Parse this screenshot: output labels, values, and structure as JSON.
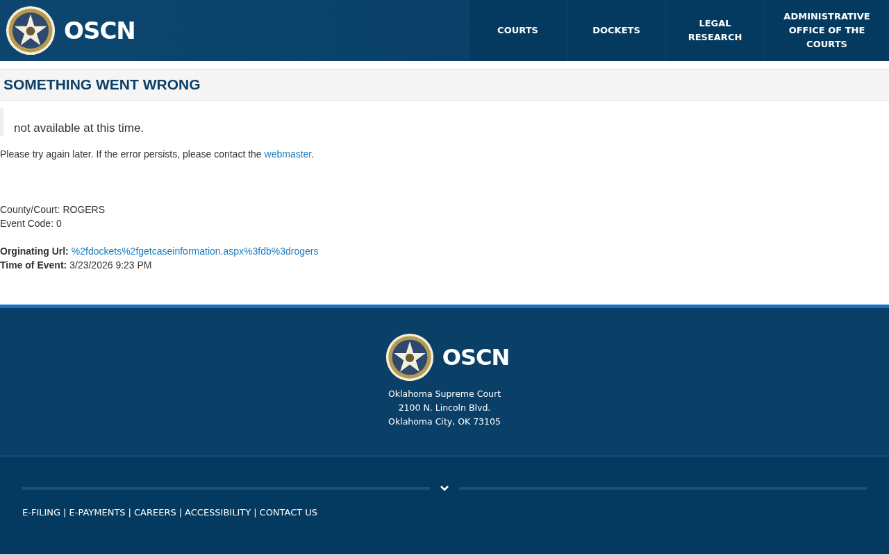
{
  "header": {
    "brand": "OSCN",
    "nav": [
      {
        "label": "COURTS"
      },
      {
        "label": "DOCKETS"
      },
      {
        "label": "LEGAL RESEARCH"
      },
      {
        "label": "ADMINISTRATIVE OFFICE OF THE COURTS"
      }
    ]
  },
  "title": "SOMETHING WENT WRONG",
  "message": "not available at this time.",
  "notice": {
    "text": "Please try again later. If the error persists, please contact the ",
    "link": "webmaster",
    "after": "."
  },
  "details": [
    {
      "label": "County/Court:",
      "value": "ROGERS",
      "bold": false,
      "link": false
    },
    {
      "label": "Event Code:",
      "value": "0",
      "bold": false,
      "link": false
    }
  ],
  "event": [
    {
      "label": "Orginating Url:",
      "value": "%2fdockets%2fgetcaseinformation.aspx%3fdb%3drogers",
      "bold": true,
      "link": true
    },
    {
      "label": "Time of Event:",
      "value": "3/23/2026 9:23 PM",
      "bold": true,
      "link": false
    }
  ],
  "footer": {
    "brand": "OSCN",
    "address": [
      "Oklahoma Supreme Court",
      "2100 N. Lincoln Blvd.",
      "Oklahoma City, OK 73105"
    ],
    "separator": "|",
    "links": [
      "E-FILING",
      "E-PAYMENTS",
      "CAREERS",
      "ACCESSIBILITY",
      "CONTACT US"
    ]
  }
}
